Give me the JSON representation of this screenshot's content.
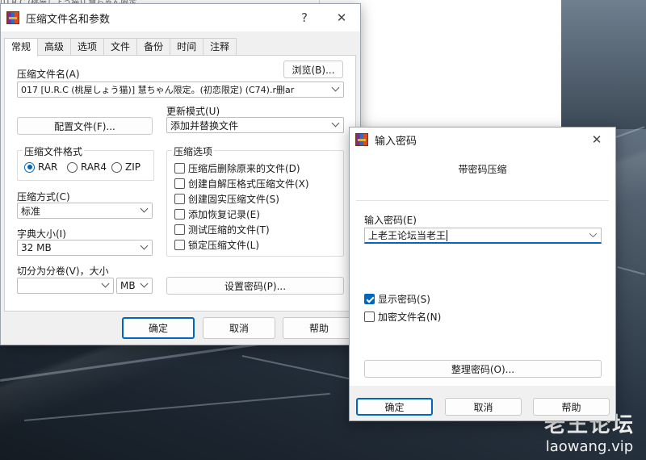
{
  "background": {
    "strip_text": "[U.R.C (桃屋しょう猫)] 慧ちゃん限定",
    "watermark_logo": "老王论坛",
    "watermark_url": "laowang.vip"
  },
  "main_dialog": {
    "title": "压缩文件名和参数",
    "help_glyph": "?",
    "close_glyph": "✕",
    "tabs": [
      "常规",
      "高级",
      "选项",
      "文件",
      "备份",
      "时间",
      "注释"
    ],
    "archive_name_label": "压缩文件名(A)",
    "browse_button": "浏览(B)...",
    "archive_name_value": "017 [U.R.C (桃屋しょう猫)] 慧ちゃん限定。(初恋限定) (C74).r删ar",
    "update_mode_label": "更新模式(U)",
    "update_mode_value": "添加并替换文件",
    "profiles_button": "配置文件(F)...",
    "format_group_title": "压缩文件格式",
    "formats": [
      {
        "label": "RAR",
        "selected": true
      },
      {
        "label": "RAR4",
        "selected": false
      },
      {
        "label": "ZIP",
        "selected": false
      }
    ],
    "options_group_title": "压缩选项",
    "options": [
      {
        "label": "压缩后删除原来的文件(D)",
        "checked": false
      },
      {
        "label": "创建自解压格式压缩文件(X)",
        "checked": false
      },
      {
        "label": "创建固实压缩文件(S)",
        "checked": false
      },
      {
        "label": "添加恢复记录(E)",
        "checked": false
      },
      {
        "label": "测试压缩的文件(T)",
        "checked": false
      },
      {
        "label": "锁定压缩文件(L)",
        "checked": false
      }
    ],
    "method_label": "压缩方式(C)",
    "method_value": "标准",
    "dict_label": "字典大小(I)",
    "dict_value": "32 MB",
    "split_label": "切分为分卷(V)，大小",
    "split_value": "",
    "split_unit": "MB",
    "set_password_button": "设置密码(P)...",
    "ok_button": "确定",
    "cancel_button": "取消",
    "help_button": "帮助"
  },
  "password_dialog": {
    "title": "输入密码",
    "close_glyph": "✕",
    "heading": "带密码压缩",
    "password_label": "输入密码(E)",
    "password_value": "上老王论坛当老王",
    "show_password_label": "显示密码(S)",
    "show_password_checked": true,
    "encrypt_names_label": "加密文件名(N)",
    "encrypt_names_checked": false,
    "organize_button": "整理密码(O)...",
    "ok_button": "确定",
    "cancel_button": "取消",
    "help_button": "帮助"
  },
  "colors": {
    "accent": "#0067c0",
    "dialog_bg": "#f0f0f0"
  }
}
